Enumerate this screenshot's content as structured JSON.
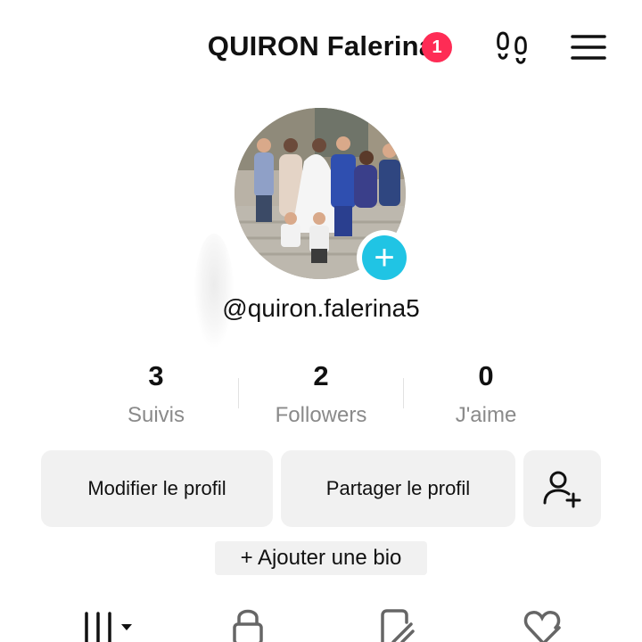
{
  "header": {
    "title": "QUIRON Falerina",
    "notification_count": "1",
    "icons": [
      "footprints-icon",
      "menu-icon"
    ]
  },
  "profile": {
    "handle": "@quiron.falerina5",
    "avatar_add_symbol": "+"
  },
  "stats": [
    {
      "value": "3",
      "label": "Suivis"
    },
    {
      "value": "2",
      "label": "Followers"
    },
    {
      "value": "0",
      "label": "J'aime"
    }
  ],
  "actions": {
    "edit_profile": "Modifier le profil",
    "share_profile": "Partager le profil",
    "add_friend_icon": "add-user-icon"
  },
  "bio": {
    "add_label": "+ Ajouter une bio"
  },
  "tabs": [
    {
      "icon": "grid-icon"
    },
    {
      "icon": "lock-icon"
    },
    {
      "icon": "repost-icon"
    },
    {
      "icon": "liked-icon"
    }
  ],
  "colors": {
    "badge": "#fe2c55",
    "add_avatar": "#20c4e4",
    "button_bg": "#f1f1f1",
    "secondary_text": "#8a8a8a"
  }
}
